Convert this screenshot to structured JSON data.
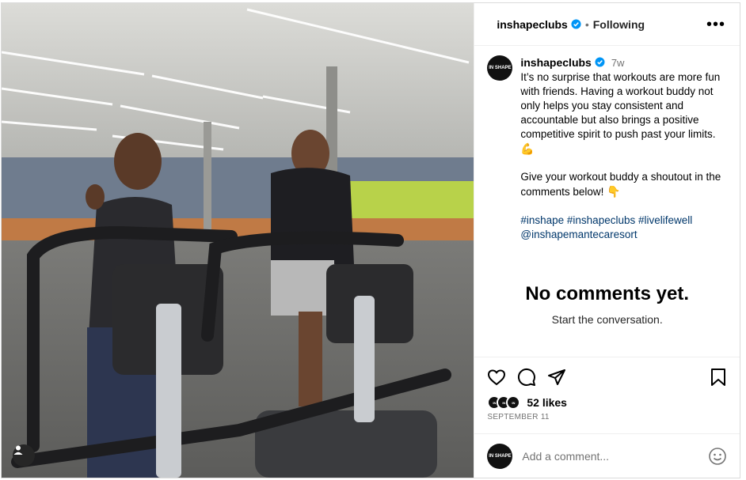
{
  "header": {
    "username": "inshapeclubs",
    "follow_state": "Following",
    "separator": "•",
    "more": "•••"
  },
  "caption": {
    "username": "inshapeclubs",
    "time": "7w",
    "text1": "It’s no surprise that workouts are more fun with friends. Having a workout buddy not only helps you stay consistent and accountable but also brings a positive competitive spirit to push past your limits.",
    "emoji1": "💪",
    "text2": "Give your workout buddy a shoutout in the comments below!",
    "emoji2": "👇",
    "hashtags": "#inshape #inshapeclubs #livelifewell",
    "mention": "@inshapemantecaresort"
  },
  "empty_state": {
    "title": "No comments yet.",
    "subtitle": "Start the conversation."
  },
  "engagement": {
    "likes": "52 likes",
    "date": "SEPTEMBER 11"
  },
  "comment": {
    "placeholder": "Add a comment..."
  },
  "avatar_label": "IN SHAPE",
  "colors": {
    "verified": "#0095f6",
    "link": "#00376b",
    "secondary": "#737373"
  },
  "icons": [
    "verified-icon",
    "heart-icon",
    "comment-icon",
    "share-icon",
    "bookmark-icon",
    "emoji-icon",
    "user-tag-icon"
  ]
}
